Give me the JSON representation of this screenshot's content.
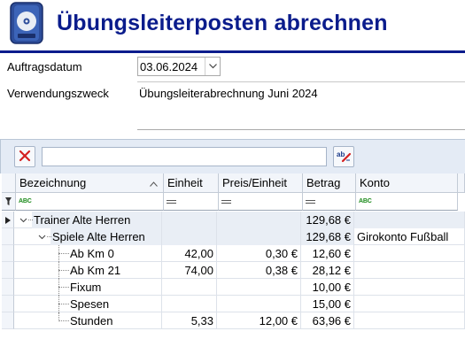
{
  "header": {
    "title": "Übungsleiterposten abrechnen",
    "icon": "save-disk-icon"
  },
  "form": {
    "date_label": "Auftragsdatum",
    "date_value": "03.06.2024",
    "purpose_label": "Verwendungszweck",
    "purpose_value": "Übungsleiterabrechnung Juni 2024"
  },
  "toolbar": {
    "clear_icon": "clear-filter-icon",
    "search_value": "",
    "spellcheck_icon": "spellcheck-icon"
  },
  "grid": {
    "columns": [
      "Bezeichnung",
      "Einheit",
      "Preis/Einheit",
      "Betrag",
      "Konto"
    ],
    "rows": [
      {
        "level": 0,
        "bezeichnung": "Trainer Alte Herren",
        "einheit": "",
        "preis": "",
        "betrag": "129,68 €",
        "konto": ""
      },
      {
        "level": 1,
        "bezeichnung": "Spiele Alte Herren",
        "einheit": "",
        "preis": "",
        "betrag": "129,68 €",
        "konto": "Girokonto Fußball"
      },
      {
        "level": 2,
        "bezeichnung": "Ab Km 0",
        "einheit": "42,00",
        "preis": "0,30 €",
        "betrag": "12,60 €",
        "konto": ""
      },
      {
        "level": 2,
        "bezeichnung": "Ab Km 21",
        "einheit": "74,00",
        "preis": "0,38 €",
        "betrag": "28,12 €",
        "konto": ""
      },
      {
        "level": 2,
        "bezeichnung": "Fixum",
        "einheit": "",
        "preis": "",
        "betrag": "10,00 €",
        "konto": ""
      },
      {
        "level": 2,
        "bezeichnung": "Spesen",
        "einheit": "",
        "preis": "",
        "betrag": "15,00 €",
        "konto": ""
      },
      {
        "level": 2,
        "bezeichnung": "Stunden",
        "einheit": "5,33",
        "preis": "12,00 €",
        "betrag": "63,96 €",
        "konto": ""
      }
    ]
  },
  "colors": {
    "title": "#0a1c8c",
    "header_bg": "#f2f5fa",
    "toolbar_bg": "#e4ebf5"
  }
}
